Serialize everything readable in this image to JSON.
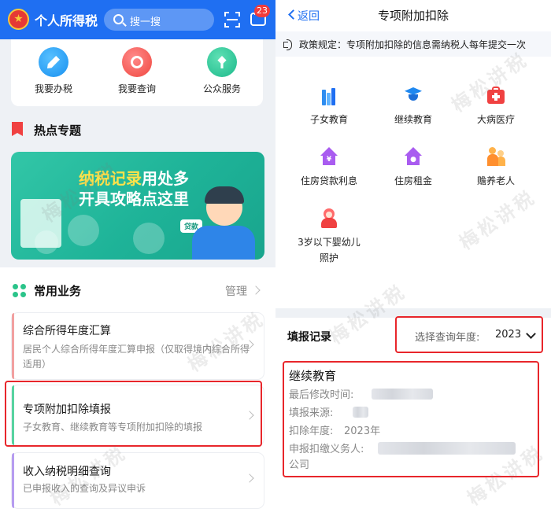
{
  "left": {
    "app_title": "个人所得税",
    "search_placeholder": "搜一搜",
    "message_badge": "23",
    "quick_actions": [
      {
        "label": "我要办税",
        "icon": "pen-icon"
      },
      {
        "label": "我要查询",
        "icon": "search-icon"
      },
      {
        "label": "公众服务",
        "icon": "leaf-icon"
      }
    ],
    "hot_title": "热点专题",
    "banner": {
      "highlight": "纳税记录",
      "line1_rest": "用处多",
      "line2": "开具攻略点这里",
      "tag": "贷款"
    },
    "common_title": "常用业务",
    "manage_label": "管理",
    "services": [
      {
        "title": "综合所得年度汇算",
        "desc": "居民个人综合所得年度汇算申报（仅取得境内综合所得适用）",
        "accent": "#f2a0a0"
      },
      {
        "title": "专项附加扣除填报",
        "desc": "子女教育、继续教育等专项附加扣除的填报",
        "accent": "#57d3a0"
      },
      {
        "title": "收入纳税明细查询",
        "desc": "已申报收入的查询及异议申诉",
        "accent": "#b69cf0"
      }
    ]
  },
  "right": {
    "back_label": "返回",
    "title": "专项附加扣除",
    "notice": "政策规定：专项附加扣除的信息需纳税人每年提交一次",
    "categories": [
      {
        "label": "子女教育",
        "icon": "books-icon"
      },
      {
        "label": "继续教育",
        "icon": "graduation-cap-icon"
      },
      {
        "label": "大病医疗",
        "icon": "medical-kit-icon"
      },
      {
        "label": "住房贷款利息",
        "icon": "house-loan-icon"
      },
      {
        "label": "住房租金",
        "icon": "house-rent-icon"
      },
      {
        "label": "赡养老人",
        "icon": "elderly-icon"
      },
      {
        "label": "3岁以下婴幼儿照护",
        "icon": "baby-icon"
      }
    ],
    "records_title": "填报记录",
    "year_select_label": "选择查询年度:",
    "year_value": "2023",
    "record": {
      "name": "继续教育",
      "modified_label": "最后修改时间:",
      "source_label": "填报来源:",
      "year_label": "扣除年度:",
      "year_value": "2023年",
      "withholder_label": "申报扣缴义务人:",
      "withholder_suffix": "公司"
    }
  },
  "watermark": "梅松讲税",
  "colors": {
    "primary_blue": "#1f6ff2",
    "highlight_red": "#e8262b",
    "banner_green": "#1eb398",
    "banner_yellow": "#ffe24a"
  }
}
